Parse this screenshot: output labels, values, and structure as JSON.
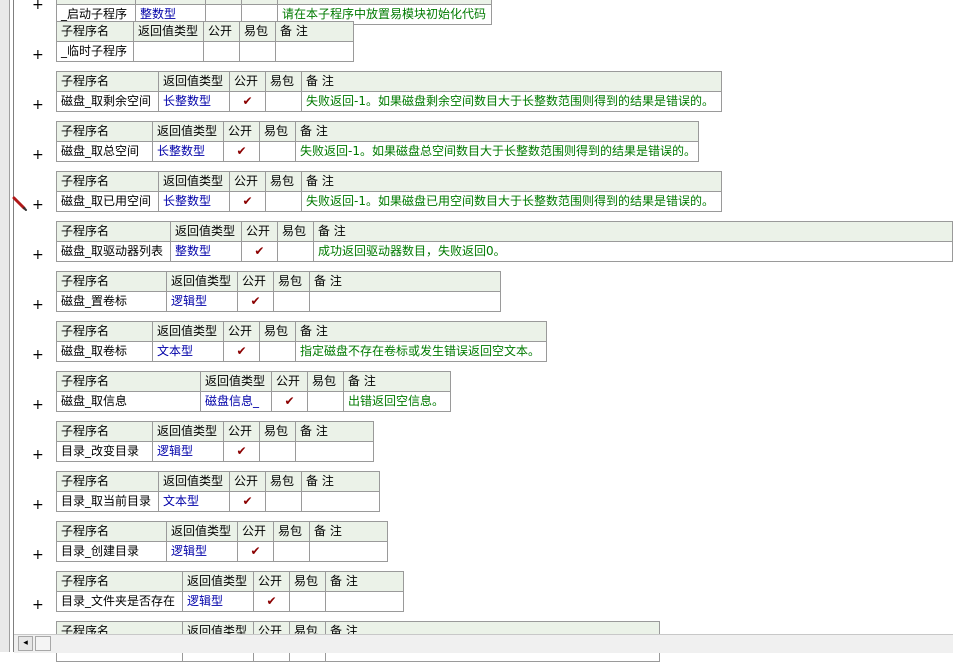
{
  "headers": {
    "name": "子程序名",
    "rettype": "返回值类型",
    "public": "公开",
    "easy": "易包",
    "remark": "备 注"
  },
  "check_mark": "✔",
  "plus_sign": "+",
  "colors": {
    "type_text": "#0000a8",
    "remark_text": "#007a00",
    "check_mark": "#8b0000",
    "header_bg": "#ebf2e8"
  },
  "icons": {
    "edit_marker": "pen-icon",
    "scroll_left": "◂"
  },
  "subroutines": [
    {
      "name": "_启动子程序",
      "type": "整数型",
      "public": "",
      "easy": "",
      "remark": "请在本子程序中放置易模块初始化代码"
    },
    {
      "name": "_临时子程序",
      "type": "",
      "public": "",
      "easy": "",
      "remark": ""
    },
    {
      "name": "磁盘_取剩余空间",
      "type": "长整数型",
      "public": "✔",
      "easy": "",
      "remark": "失败返回-1。如果磁盘剩余空间数目大于长整数范围则得到的结果是错误的。"
    },
    {
      "name": "磁盘_取总空间",
      "type": "长整数型",
      "public": "✔",
      "easy": "",
      "remark": "失败返回-1。如果磁盘总空间数目大于长整数范围则得到的结果是错误的。"
    },
    {
      "name": "磁盘_取已用空间",
      "type": "长整数型",
      "public": "✔",
      "easy": "",
      "remark": "失败返回-1。如果磁盘已用空间数目大于长整数范围则得到的结果是错误的。"
    },
    {
      "name": "磁盘_取驱动器列表",
      "type": "整数型",
      "public": "✔",
      "easy": "",
      "remark": "成功返回驱动器数目，失败返回0。"
    },
    {
      "name": "磁盘_置卷标",
      "type": "逻辑型",
      "public": "✔",
      "easy": "",
      "remark": ""
    },
    {
      "name": "磁盘_取卷标",
      "type": "文本型",
      "public": "✔",
      "easy": "",
      "remark": "指定磁盘不存在卷标或发生错误返回空文本。"
    },
    {
      "name": "磁盘_取信息",
      "type": "磁盘信息_",
      "public": "✔",
      "easy": "",
      "remark": "出错返回空信息。"
    },
    {
      "name": "目录_改变目录",
      "type": "逻辑型",
      "public": "✔",
      "easy": "",
      "remark": ""
    },
    {
      "name": "目录_取当前目录",
      "type": "文本型",
      "public": "✔",
      "easy": "",
      "remark": ""
    },
    {
      "name": "目录_创建目录",
      "type": "逻辑型",
      "public": "✔",
      "easy": "",
      "remark": ""
    },
    {
      "name": "目录_文件夹是否存在",
      "type": "逻辑型",
      "public": "✔",
      "easy": "",
      "remark": ""
    },
    {
      "name": "",
      "type": "",
      "public": "",
      "easy": "",
      "remark": ""
    }
  ]
}
